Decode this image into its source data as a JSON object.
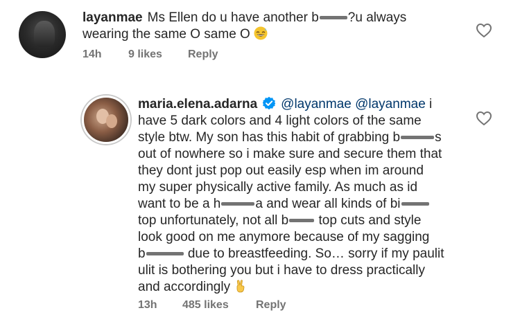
{
  "comments": [
    {
      "username": "layanmae",
      "text_line1_a": "Ms Ellen do u have another b",
      "text_line1_b": "?u always",
      "text_line2": "wearing the same O same O",
      "emoji": "grinning-sweat-emoji",
      "time": "14h",
      "likes": "9 likes",
      "reply": "Reply"
    },
    {
      "username": "maria.elena.adarna",
      "verified": true,
      "mentions": "@layanmae @layanmae",
      "l1_tail": " i",
      "l2": "have 5 dark colors and 4 light colors of the same",
      "l3_a": "style btw. My son has this habit of grabbing b",
      "l3_b": "s",
      "l4": "out of nowhere so i make sure and secure them that",
      "l5": "they dont just pop out easily esp when im around",
      "l6": "my super physically active family. As much as id",
      "l7_a": "want to be a h",
      "l7_b": "a and wear all kinds of bi",
      "l8_a": "top unfortunately, not all b",
      "l8_b": " top cuts and style",
      "l9": "look good on me anymore because of my sagging",
      "l10_a": "b",
      "l10_b": " due to breastfeeding. So… sorry if my paulit",
      "l11": "ulit is bothering you but i have to dress practically",
      "l12": "and accordingly",
      "emoji": "victory-hand-emoji",
      "time": "13h",
      "likes": "485 likes",
      "reply": "Reply"
    }
  ],
  "icons": {
    "like": "heart-outline-icon",
    "verified": "verified-badge-icon"
  },
  "colors": {
    "text": "#262626",
    "meta": "#737373",
    "mention": "#00376b",
    "verified": "#0095f6"
  }
}
